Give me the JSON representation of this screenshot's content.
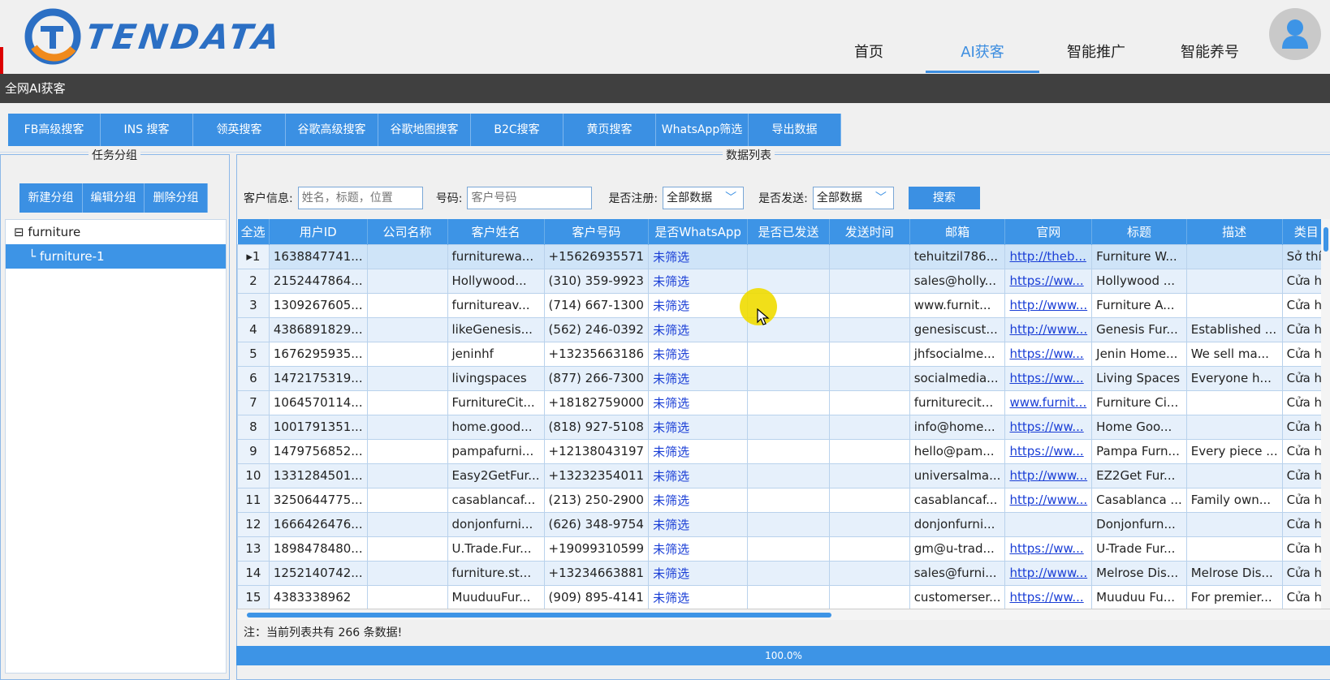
{
  "header": {
    "logo_text": "TENDATA",
    "nav": [
      {
        "label": "首页"
      },
      {
        "label": "AI获客",
        "active": true
      },
      {
        "label": "智能推广"
      },
      {
        "label": "智能养号"
      }
    ]
  },
  "title_bar": "全网AI获客",
  "toolbar": {
    "buttons": [
      "FB高级搜客",
      "INS 搜客",
      "领英搜客",
      "谷歌高级搜客",
      "谷歌地图搜客",
      "B2C搜客",
      "黄页搜客",
      "WhatsApp筛选",
      "导出数据"
    ]
  },
  "left_panel": {
    "title": "任务分组",
    "buttons": [
      "新建分组",
      "编辑分组",
      "删除分组"
    ],
    "tree": {
      "root": "furniture",
      "child": "furniture-1"
    }
  },
  "right_panel": {
    "title": "数据列表",
    "filters": {
      "customer_info_label": "客户信息:",
      "customer_info_placeholder": "姓名，标题，位置",
      "phone_label": "号码:",
      "phone_placeholder": "客户号码",
      "registered_label": "是否注册:",
      "registered_value": "全部数据",
      "sent_label": "是否发送:",
      "sent_value": "全部数据",
      "search_button": "搜索"
    },
    "columns": [
      "全选",
      "用户ID",
      "公司名称",
      "客户姓名",
      "客户号码",
      "是否WhatsApp",
      "是否已发送",
      "发送时间",
      "邮箱",
      "官网",
      "标题",
      "描述",
      "类目"
    ],
    "rows": [
      [
        "1",
        "1638847741...",
        "",
        "furniturewa...",
        "+15626935571",
        "未筛选",
        "",
        "",
        "tehuitzil786...",
        "http://theb...",
        "Furniture W...",
        "",
        "Sở thí"
      ],
      [
        "2",
        "2152447864...",
        "",
        "Hollywood...",
        "(310) 359-9923",
        "未筛选",
        "",
        "",
        "sales@holly...",
        "https://ww...",
        "Hollywood ...",
        "",
        "Cửa h"
      ],
      [
        "3",
        "1309267605...",
        "",
        "furnitureav...",
        "(714) 667-1300",
        "未筛选",
        "",
        "",
        "www.furnit...",
        "http://www...",
        "Furniture A...",
        "",
        "Cửa h"
      ],
      [
        "4",
        "4386891829...",
        "",
        "likeGenesis...",
        "(562) 246-0392",
        "未筛选",
        "",
        "",
        "genesiscust...",
        "http://www...",
        "Genesis Fur...",
        "Established ...",
        "Cửa h"
      ],
      [
        "5",
        "1676295935...",
        "",
        "jeninhf",
        "+13235663186",
        "未筛选",
        "",
        "",
        "jhfsocialme...",
        "https://ww...",
        "Jenin Home...",
        "We sell ma...",
        "Cửa h"
      ],
      [
        "6",
        "1472175319...",
        "",
        "livingspaces",
        "(877) 266-7300",
        "未筛选",
        "",
        "",
        "socialmedia...",
        "https://ww...",
        "Living Spaces",
        "Everyone h...",
        "Cửa h"
      ],
      [
        "7",
        "1064570114...",
        "",
        "FurnitureCit...",
        "+18182759000",
        "未筛选",
        "",
        "",
        "furniturecit...",
        "www.furnit...",
        "Furniture Ci...",
        "",
        "Cửa h"
      ],
      [
        "8",
        "1001791351...",
        "",
        "home.good...",
        "(818) 927-5108",
        "未筛选",
        "",
        "",
        "info@home...",
        "https://ww...",
        "Home Goo...",
        "",
        "Cửa h"
      ],
      [
        "9",
        "1479756852...",
        "",
        "pampafurni...",
        "+12138043197",
        "未筛选",
        "",
        "",
        "hello@pam...",
        "https://ww...",
        "Pampa Furn...",
        "Every piece ...",
        "Cửa h"
      ],
      [
        "10",
        "1331284501...",
        "",
        "Easy2GetFur...",
        "+13232354011",
        "未筛选",
        "",
        "",
        "universalma...",
        "http://www...",
        "EZ2Get Fur...",
        "",
        "Cửa h"
      ],
      [
        "11",
        "3250644775...",
        "",
        "casablancaf...",
        "(213) 250-2900",
        "未筛选",
        "",
        "",
        "casablancaf...",
        "http://www...",
        "Casablanca ...",
        "Family own...",
        "Cửa h"
      ],
      [
        "12",
        "1666426476...",
        "",
        "donjonfurni...",
        "(626) 348-9754",
        "未筛选",
        "",
        "",
        "donjonfurni...",
        "",
        "Donjonfurn...",
        "",
        "Cửa h"
      ],
      [
        "13",
        "1898478480...",
        "",
        "U.Trade.Fur...",
        "+19099310599",
        "未筛选",
        "",
        "",
        "gm@u-trad...",
        "https://ww...",
        "U-Trade Fur...",
        "",
        "Cửa h"
      ],
      [
        "14",
        "1252140742...",
        "",
        "furniture.st...",
        "+13234663881",
        "未筛选",
        "",
        "",
        "sales@furni...",
        "http://www...",
        "Melrose Dis...",
        "Melrose Dis...",
        "Cửa h"
      ],
      [
        "15",
        "4383338962",
        "",
        "MuuduuFur...",
        "(909) 895-4141",
        "未筛选",
        "",
        "",
        "customerser...",
        "https://ww...",
        "Muuduu Fu...",
        "For premier...",
        "Cửa h"
      ]
    ],
    "note": "注：当前列表共有 266 条数据!",
    "progress": "100.0%"
  },
  "colors": {
    "accent": "#3d94e6",
    "title_bar": "#404040",
    "link": "#1a3ed6"
  }
}
